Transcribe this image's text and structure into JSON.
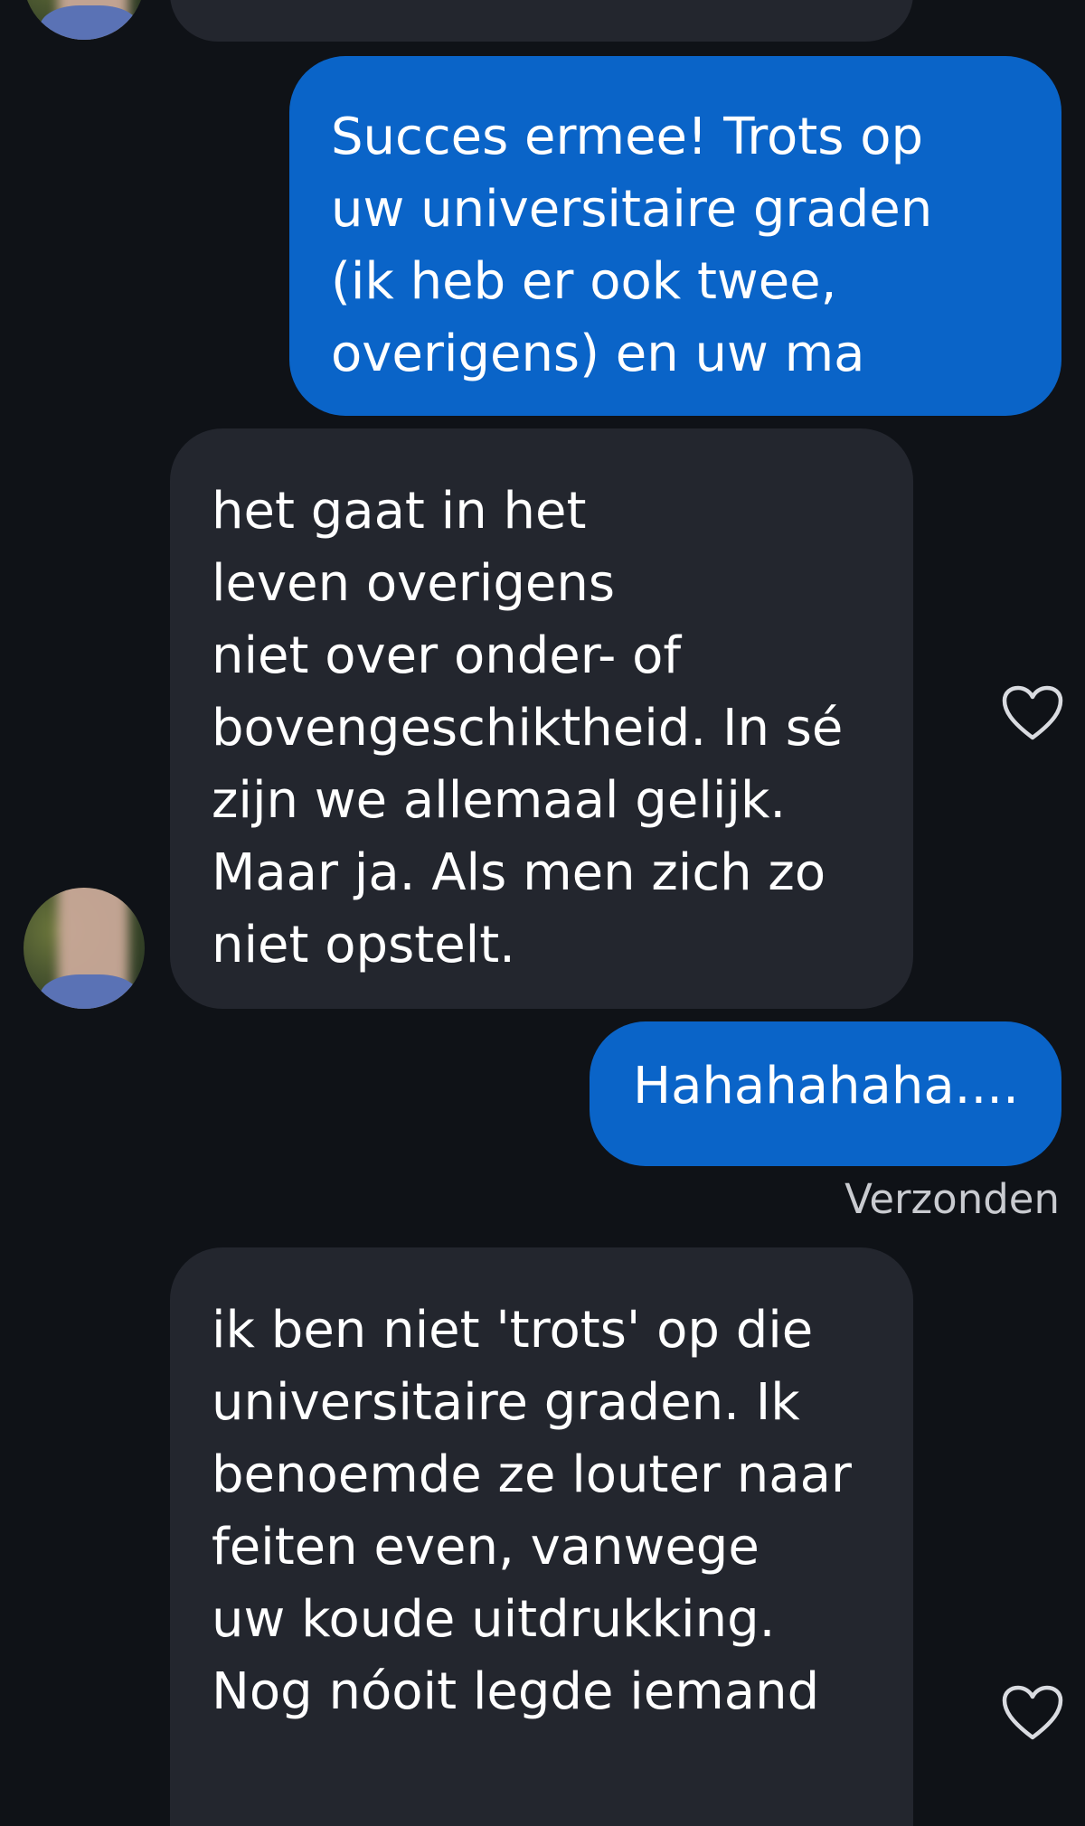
{
  "messages": {
    "sent_1": "Succes ermee! Trots op\nuw universitaire graden\n(ik heb er ook twee,\noverigens) en uw ma",
    "received_1": "het gaat in het\nleven overigens\nniet over onder- of\nbovengeschiktheid. In sé\nzijn we allemaal gelijk.\nMaar ja. Als men zich zo\nniet opstelt.",
    "sent_2": "Hahahahaha....",
    "status_sent": "Verzonden",
    "received_2": "ik ben niet 'trots' op die\nuniversitaire graden. Ik\nbenoemde ze louter naar\nfeiten even, vanwege\nuw koude uitdrukking.\nNog nóoit legde iemand"
  },
  "colors": {
    "background": "#0f1217",
    "sent_bubble": "#0a64c8",
    "received_bubble": "#23262e",
    "status_text": "#c9cbd0"
  },
  "icons": {
    "like": "heart-outline-icon",
    "avatar": "blurred-profile-photo"
  }
}
